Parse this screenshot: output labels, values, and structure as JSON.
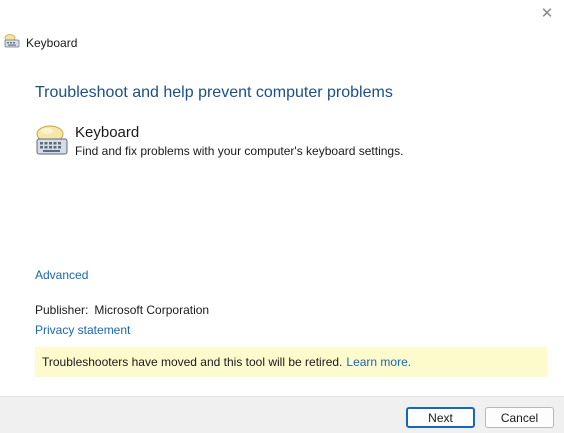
{
  "window": {
    "title": "Keyboard",
    "close_glyph": "✕"
  },
  "main": {
    "heading": "Troubleshoot and help prevent computer problems",
    "item": {
      "title": "Keyboard",
      "description": "Find and fix problems with your computer's keyboard settings.",
      "icon": "keyboard-troubleshooter-icon"
    },
    "advanced_link": "Advanced",
    "publisher_label": "Publisher:",
    "publisher_value": "Microsoft Corporation",
    "privacy_link": "Privacy statement"
  },
  "banner": {
    "text": "Troubleshooters have moved and this tool will be retired.",
    "link": "Learn more."
  },
  "footer": {
    "next_label": "Next",
    "cancel_label": "Cancel"
  },
  "colors": {
    "heading": "#1c4f8a",
    "link": "#1767b8",
    "banner_bg": "#fdfacd",
    "footer_bg": "#f0f0f0"
  }
}
